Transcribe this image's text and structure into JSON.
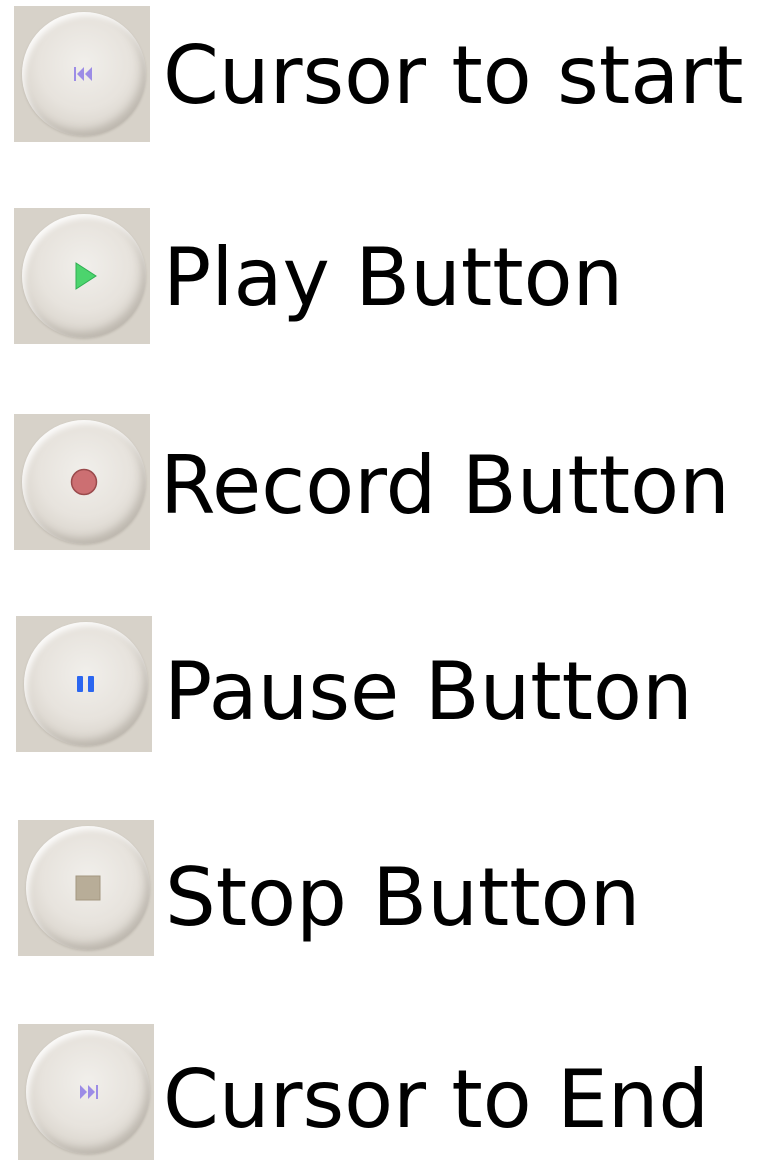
{
  "colors": {
    "tile_background": "#d7d2c9",
    "skip_icon": "#9c8ce6",
    "play_icon": "#4cd46d",
    "record_icon": "#cc6f72",
    "pause_icon": "#2b66f0",
    "stop_icon": "#b8ad98"
  },
  "items": [
    {
      "label": "Cursor to start",
      "icon": "skip-to-start-icon"
    },
    {
      "label": "Play Button",
      "icon": "play-icon"
    },
    {
      "label": "Record Button",
      "icon": "record-icon"
    },
    {
      "label": "Pause Button",
      "icon": "pause-icon"
    },
    {
      "label": "Stop Button",
      "icon": "stop-icon"
    },
    {
      "label": "Cursor to End",
      "icon": "skip-to-end-icon"
    }
  ]
}
